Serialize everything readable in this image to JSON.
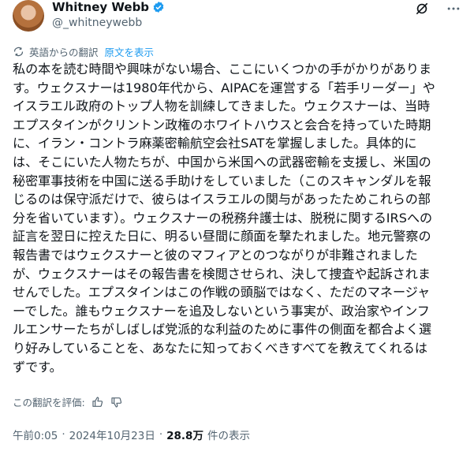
{
  "author": {
    "name": "Whitney Webb",
    "handle": "@_whitneywebb"
  },
  "translation": {
    "label": "英語からの翻訳",
    "show_original": "原文を表示"
  },
  "post": {
    "lines": [
      "私の本を読む時間や興味がない場合、ここにいくつかの手がかりがありま",
      "す。ウェクスナーは1980年代から、AIPACを運営する「若手リーダー」や",
      "イスラエル政府のトップ人物を訓練してきました。ウェクスナーは、当時",
      "エプスタインがクリントン政権のホワイトハウスと会合を持っていた時期",
      "に、イラン・コントラ麻薬密輸航空会社SATを掌握しました。具体的に",
      "は、そこにいた人物たちが、中国から米国への武器密輸を支援し、米国の",
      "秘密軍事技術を中国に送る手助けをしていました（このスキャンダルを報",
      "じるのは保守派だけで、彼らはイスラエルの関与があったためこれらの部",
      "分を省いています）。ウェクスナーの税務弁護士は、脱税に関するIRSへの",
      "証言を翌日に控えた日に、明るい昼間に顔面を撃たれました。地元警察の",
      "報告書ではウェクスナーと彼のマフィアとのつながりが非難されました",
      "が、ウェクスナーはその報告書を検閲させられ、決して捜査や起訴されま",
      "せんでした。エプスタインはこの作戦の頭脳ではなく、ただのマネージャ",
      "ーでした。誰もウェクスナーを追及しないという事実が、政治家やインフ",
      "ルエンサーたちがしばしば党派的な利益のために事件の側面を都合よく選",
      "り好みしていることを、あなたに知っておくべきすべてを教えてくれるは",
      "ずです。"
    ]
  },
  "rating": {
    "label": "この翻訳を評価:"
  },
  "meta": {
    "time": "午前0:05",
    "separator1": "·",
    "date": "2024年10月23日",
    "separator2": "·",
    "views_count": "28.8万",
    "views_label": "件の表示"
  },
  "colors": {
    "accent": "#1d9bf0",
    "secondary_text": "#536471",
    "primary_text": "#0f1419"
  },
  "icons": [
    "verified-badge-icon",
    "grok-icon",
    "more-icon",
    "translate-icon",
    "thumbs-up-icon",
    "thumbs-down-icon"
  ]
}
